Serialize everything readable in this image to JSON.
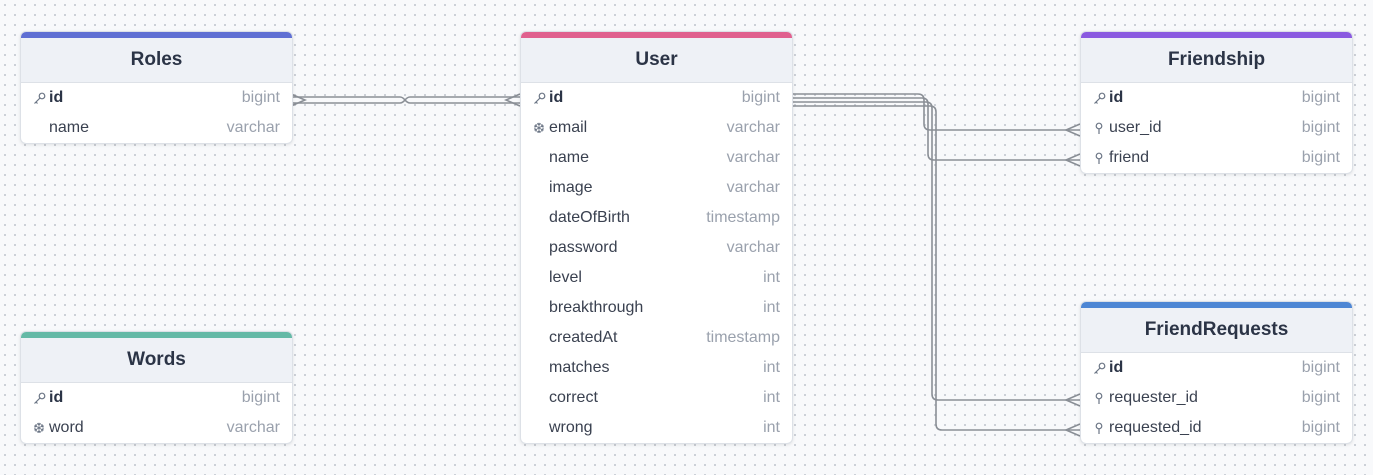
{
  "colors": {
    "roles": "#5f6fd3",
    "user": "#e0608e",
    "friendship": "#8a5ae0",
    "words": "#64b9a6",
    "friendrequests": "#4d86d4",
    "edge": "#8a8f96"
  },
  "tables": {
    "roles": {
      "title": "Roles",
      "fields": [
        {
          "name": "id",
          "type": "bigint",
          "icon": "key-icon"
        },
        {
          "name": "name",
          "type": "varchar",
          "icon": ""
        }
      ]
    },
    "user": {
      "title": "User",
      "fields": [
        {
          "name": "id",
          "type": "bigint",
          "icon": "key-icon"
        },
        {
          "name": "email",
          "type": "varchar",
          "icon": "unique-icon"
        },
        {
          "name": "name",
          "type": "varchar",
          "icon": ""
        },
        {
          "name": "image",
          "type": "varchar",
          "icon": ""
        },
        {
          "name": "dateOfBirth",
          "type": "timestamp",
          "icon": ""
        },
        {
          "name": "password",
          "type": "varchar",
          "icon": ""
        },
        {
          "name": "level",
          "type": "int",
          "icon": ""
        },
        {
          "name": "breakthrough",
          "type": "int",
          "icon": ""
        },
        {
          "name": "createdAt",
          "type": "timestamp",
          "icon": ""
        },
        {
          "name": "matches",
          "type": "int",
          "icon": ""
        },
        {
          "name": "correct",
          "type": "int",
          "icon": ""
        },
        {
          "name": "wrong",
          "type": "int",
          "icon": ""
        }
      ]
    },
    "friendship": {
      "title": "Friendship",
      "fields": [
        {
          "name": "id",
          "type": "bigint",
          "icon": "key-icon"
        },
        {
          "name": "user_id",
          "type": "bigint",
          "icon": "foreign-key-icon"
        },
        {
          "name": "friend",
          "type": "bigint",
          "icon": "foreign-key-icon"
        }
      ]
    },
    "words": {
      "title": "Words",
      "fields": [
        {
          "name": "id",
          "type": "bigint",
          "icon": "key-icon"
        },
        {
          "name": "word",
          "type": "varchar",
          "icon": "unique-icon"
        }
      ]
    },
    "friendrequests": {
      "title": "FriendRequests",
      "fields": [
        {
          "name": "id",
          "type": "bigint",
          "icon": "key-icon"
        },
        {
          "name": "requester_id",
          "type": "bigint",
          "icon": "foreign-key-icon"
        },
        {
          "name": "requested_id",
          "type": "bigint",
          "icon": "foreign-key-icon"
        }
      ]
    }
  },
  "relations": [
    {
      "from": "roles.id",
      "to": "user.id",
      "type": "many-to-many"
    },
    {
      "from": "user.id",
      "to": "friendship.user_id",
      "type": "one-to-many"
    },
    {
      "from": "user.id",
      "to": "friendship.friend",
      "type": "one-to-many"
    },
    {
      "from": "user.id",
      "to": "friendrequests.requester_id",
      "type": "one-to-many"
    },
    {
      "from": "user.id",
      "to": "friendrequests.requested_id",
      "type": "one-to-many"
    }
  ]
}
